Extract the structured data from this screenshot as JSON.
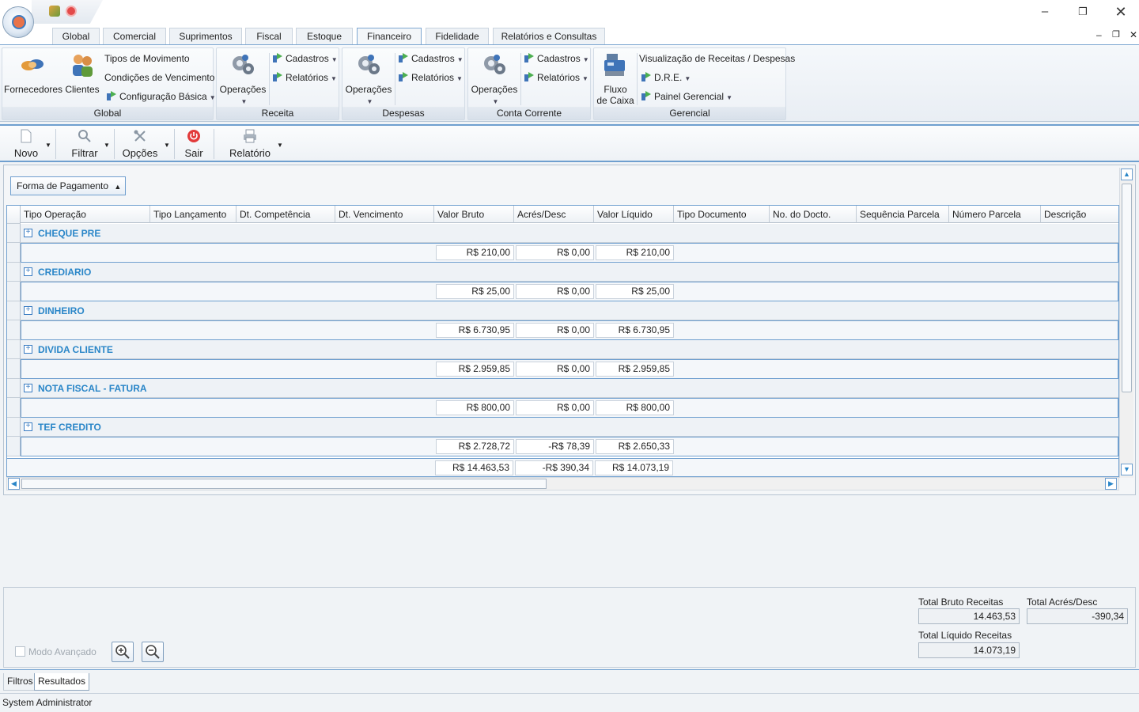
{
  "tabs": [
    "Global",
    "Comercial",
    "Suprimentos",
    "Fiscal",
    "Estoque",
    "Financeiro",
    "Fidelidade",
    "Relatórios e Consultas"
  ],
  "ribbon": {
    "global": {
      "label": "Global",
      "fornecedores": "Fornecedores",
      "clientes": "Clientes",
      "tipos_movimento": "Tipos de Movimento",
      "condicoes_vencimento": "Condições de Vencimento",
      "configuracao_basica": "Configuração Básica"
    },
    "receita": {
      "label": "Receita",
      "operacoes": "Operações",
      "cadastros": "Cadastros",
      "relatorios": "Relatórios"
    },
    "despesas": {
      "label": "Despesas",
      "operacoes": "Operações",
      "cadastros": "Cadastros",
      "relatorios": "Relatórios"
    },
    "conta_corrente": {
      "label": "Conta Corrente",
      "operacoes": "Operações",
      "cadastros": "Cadastros",
      "relatorios": "Relatórios"
    },
    "gerencial": {
      "label": "Gerencial",
      "fluxo_line1": "Fluxo",
      "fluxo_line2": "de Caixa",
      "visualizacao": "Visualização de Receitas / Despesas",
      "dre": "D.R.E.",
      "painel": "Painel Gerencial"
    }
  },
  "toolbar": {
    "novo": "Novo",
    "filtrar": "Filtrar",
    "opcoes": "Opções",
    "sair": "Sair",
    "relatorio": "Relatório"
  },
  "group_by": "Forma de Pagamento",
  "columns": [
    "Tipo Operação",
    "Tipo Lançamento",
    "Dt. Competência",
    "Dt. Vencimento",
    "Valor Bruto",
    "Acrés/Desc",
    "Valor Líquido",
    "Tipo Documento",
    "No. do Docto.",
    "Sequência Parcela",
    "Número Parcela",
    "Descrição"
  ],
  "groups": [
    {
      "name": "CHEQUE PRE",
      "bruto": "R$ 210,00",
      "acres": "R$ 0,00",
      "liquido": "R$ 210,00"
    },
    {
      "name": "CREDIARIO",
      "bruto": "R$ 25,00",
      "acres": "R$ 0,00",
      "liquido": "R$ 25,00"
    },
    {
      "name": "DINHEIRO",
      "bruto": "R$ 6.730,95",
      "acres": "R$ 0,00",
      "liquido": "R$ 6.730,95"
    },
    {
      "name": "DIVIDA CLIENTE",
      "bruto": "R$ 2.959,85",
      "acres": "R$ 0,00",
      "liquido": "R$ 2.959,85"
    },
    {
      "name": "NOTA FISCAL - FATURA",
      "bruto": "R$ 800,00",
      "acres": "R$ 0,00",
      "liquido": "R$ 800,00"
    },
    {
      "name": "TEF CREDITO",
      "bruto": "R$ 2.728,72",
      "acres": "-R$ 78,39",
      "liquido": "R$ 2.650,33"
    }
  ],
  "grand_total": {
    "bruto": "R$ 14.463,53",
    "acres": "-R$ 390,34",
    "liquido": "R$ 14.073,19"
  },
  "summary": {
    "total_bruto_label": "Total Bruto Receitas",
    "total_bruto": "14.463,53",
    "total_acres_label": "Total Acrés/Desc",
    "total_acres": "-390,34",
    "total_liquido_label": "Total Líquido Receitas",
    "total_liquido": "14.073,19",
    "modo_avancado": "Modo Avançado"
  },
  "bottom_tabs": [
    "Filtros",
    "Resultados"
  ],
  "status": "System Administrator",
  "colors": {
    "accent": "#6f9fcf",
    "group_text": "#2a86c8"
  }
}
